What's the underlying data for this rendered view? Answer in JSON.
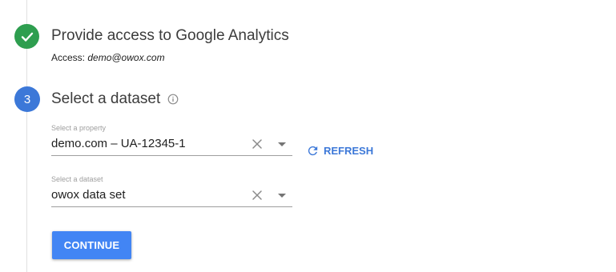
{
  "steps": {
    "access": {
      "status_icon": "check-icon",
      "title": "Provide access to Google Analytics",
      "access_label": "Access:",
      "access_email": "demo@owox.com"
    },
    "dataset": {
      "number": "3",
      "title": "Select a dataset",
      "info_icon": "info-icon"
    }
  },
  "form": {
    "property": {
      "label": "Select a property",
      "value": "demo.com – UA-12345-1"
    },
    "refresh": {
      "label": "REFRESH",
      "icon": "refresh-icon"
    },
    "dataset": {
      "label": "Select a dataset",
      "value": "owox data set"
    },
    "continue_label": "CONTINUE"
  },
  "colors": {
    "done": "#2e9e4f",
    "active_step": "#3c78d8",
    "primary_button": "#4285f4",
    "link": "#3c78d8"
  }
}
